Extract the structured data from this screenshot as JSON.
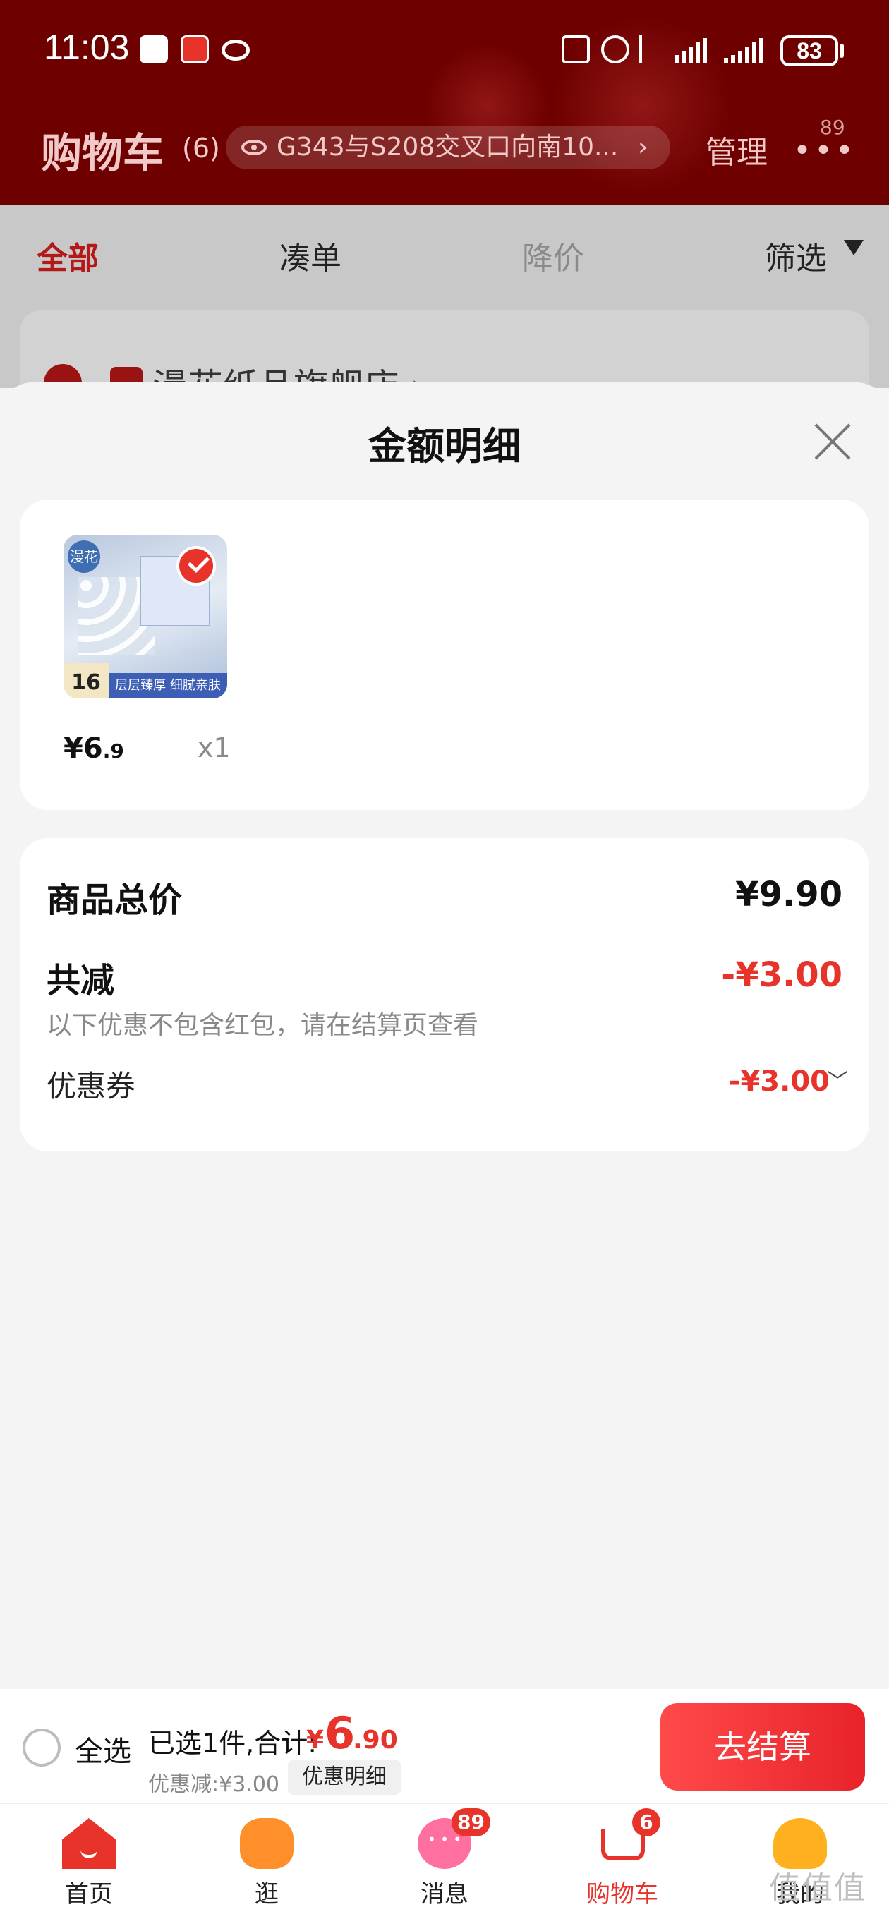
{
  "status_bar": {
    "time": "11:03",
    "battery": "83"
  },
  "header": {
    "title": "购物车",
    "count": "(6)",
    "address": "G343与S208交叉口向南10...",
    "address_chevron": "›",
    "manage": "管理",
    "more": "•••",
    "more_badge": "89"
  },
  "filter_tabs": {
    "all": "全部",
    "bundle": "凑单",
    "discount": "降价",
    "filter": "筛选"
  },
  "store": {
    "name": "漫花纸品旗舰店 ›"
  },
  "sheet": {
    "title": "金额明细",
    "product": {
      "brand": "漫花",
      "badge": "16",
      "banner": "层层臻厚 细腻亲肤",
      "price_symbol": "¥",
      "price_int": "6",
      "price_dec": ".9",
      "qty": "x1"
    },
    "details": {
      "total_label": "商品总价",
      "total_value": "¥9.90",
      "reduce_label": "共减",
      "reduce_value": "-¥3.00",
      "note": "以下优惠不包含红包，请在结算页查看",
      "coupon_label": "优惠券",
      "coupon_value": "-¥3.00",
      "coupon_chevron": "﹀"
    }
  },
  "checkout": {
    "select_all": "全选",
    "selected_summary": "已选1件,合计:",
    "total_symbol": "¥",
    "total_int": "6",
    "total_dec": ".90",
    "saved": "优惠减:¥3.00",
    "detail_button": "优惠明细",
    "checkout_button": "去结算"
  },
  "tab_bar": {
    "home": "首页",
    "browse": "逛",
    "messages": "消息",
    "messages_badge": "89",
    "cart": "购物车",
    "cart_badge": "6",
    "me": "我的"
  },
  "watermark": "值值值",
  "colors": {
    "header_bg": "#6e0000",
    "accent": "#e8332a",
    "tab_active": "#b51818"
  }
}
